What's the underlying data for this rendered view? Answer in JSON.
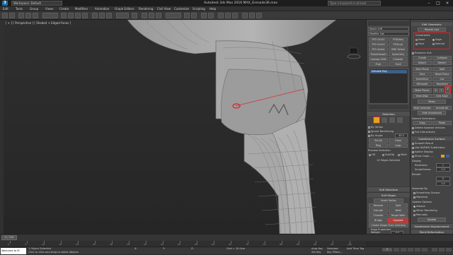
{
  "titlebar": {
    "workspace": "Workspace: Default",
    "title": "Autodesk 3ds Max 2016    MAX_Grenade36.max",
    "search_placeholder": "Type a keyword or phrase"
  },
  "menubar": {
    "items": [
      "Edit",
      "Tools",
      "Group",
      "Views",
      "Create",
      "Modifiers",
      "Animation",
      "Graph Editors",
      "Rendering",
      "Civil View",
      "Customize",
      "Scripting",
      "Help"
    ]
  },
  "viewport": {
    "label": "[ + ] [ Perspective ] [ Shaded + Edged Faces ]"
  },
  "command_panel_left": {
    "object_name": "Spoon Left",
    "modifier_list": "Modifier List",
    "buttons": [
      [
        "FFD 2x2x2",
        "FFD(box)"
      ],
      [
        "FFD 3x3x3",
        "FFD(cyl)"
      ],
      [
        "FFD 4x4x4",
        "MSE Select"
      ],
      [
        "TurboSmooth",
        "Symmetry"
      ],
      [
        "Unwrap UVW",
        "Chamfer"
      ],
      [
        "Push",
        "Shell"
      ]
    ],
    "stack_item": "Editable Poly",
    "selection_header": "Selection",
    "by_vertex": "By Vertex",
    "ignore_backfacing": "Ignore Backfacing",
    "by_angle": "By Angle:",
    "by_angle_value": "45.0",
    "shrink": "Shrink",
    "grow": "Grow",
    "ring": "Ring",
    "loop": "Loop",
    "preview_selection": "Preview Selection",
    "preview_opts": [
      "Off",
      "SubObj",
      "Multi"
    ],
    "selected_status": "12 Edges Selected",
    "soft_selection": "Soft Selection",
    "edit_edges": "Edit Edges",
    "insert_vertex": "Insert Vertex",
    "remove": "Remove",
    "split": "Split",
    "extrude": "Extrude",
    "weld": "Weld",
    "chamfer": "Chamfer",
    "target_weld": "Target Weld",
    "bridge": "Bridge",
    "connect": "Connect",
    "create_shape": "Create Shape From Selection",
    "edge_properties": "Edge Properties",
    "weight_label": "Weight:",
    "weight_value": "1.0",
    "crease_label": "Crease:",
    "crease_value": "0.0",
    "hard": "Hard",
    "smooth": "Smooth",
    "display_hard_edges": "Display Hard Edges"
  },
  "command_panel_right": {
    "edit_geometry": "Edit Geometry",
    "repeat_last": "Repeat Last",
    "constraints": "Constraints",
    "constraint_opts": [
      "None",
      "Edge",
      "Face",
      "Normal"
    ],
    "preserve_uvs": "Preserve UVs",
    "create": "Create",
    "collapse": "Collapse",
    "attach": "Attach",
    "detach": "Detach",
    "slice_plane": "Slice Plane",
    "split": "Split",
    "slice": "Slice",
    "reset_plane": "Reset Plane",
    "quickslice": "QuickSlice",
    "cut": "Cut",
    "meshsmooth": "MSmooth",
    "tessellate": "Tessellate",
    "make_planar": "Make Planar",
    "xyz": [
      "X",
      "Y",
      "Z"
    ],
    "view_align": "View Align",
    "grid_align": "Grid Align",
    "relax": "Relax",
    "hide_selected": "Hide Selected",
    "unhide_all": "Unhide All",
    "hide_unselected": "Hide Unselected",
    "named_selections": "Named Selections:",
    "copy": "Copy",
    "paste": "Paste",
    "delete_isolated": "Delete Isolated Vertices",
    "full_interactivity": "Full Interactivity",
    "subdivision_surface": "Subdivision Surface",
    "smooth_result": "Smooth Result",
    "use_nurms": "Use NURMS Subdivision",
    "isoline_display": "Isoline Display",
    "show_cage": "Show Cage......",
    "display": "Display",
    "iterations_label": "Iterations:",
    "iterations_value": "1",
    "smoothness_label": "Smoothness:",
    "smoothness_value": "1.0",
    "render": "Render",
    "render_iterations_value": "0",
    "render_smoothness_value": "1.0",
    "separate_by": "Separate By",
    "smoothing_groups": "Smoothing Groups",
    "materials": "Materials",
    "update_options": "Update Options",
    "always": "Always",
    "when_rendering": "When Rendering",
    "manually": "Manually",
    "update": "Update",
    "subdivision_displacement": "Subdivision Displacement",
    "paint_deformation": "Paint Deformation"
  },
  "timeline": {
    "frame_readout": "0 / 100",
    "ticks": [
      "0",
      "5",
      "10",
      "15",
      "20",
      "25",
      "30",
      "35",
      "40",
      "45",
      "50",
      "55",
      "60",
      "65",
      "70",
      "75",
      "80",
      "85",
      "90",
      "95",
      "100"
    ]
  },
  "statusbar": {
    "maxscript": "Welcome to M",
    "status1": "1 Object Selected",
    "status2": "Click or click-and-drag to select objects",
    "x_label": "X:",
    "y_label": "Y:",
    "z_label": "Z:",
    "grid": "Grid = 10.0cm",
    "auto_key": "Auto Key",
    "selected": "Selected",
    "set_key": "Set Key",
    "key_filters": "Key Filters...",
    "add_time_tag": "Add Time Tag",
    "frame": "0"
  },
  "colors": {
    "highlight_red": "#e02020",
    "selection_orange": "#e8a020",
    "accent_blue": "#1f6fa8"
  }
}
